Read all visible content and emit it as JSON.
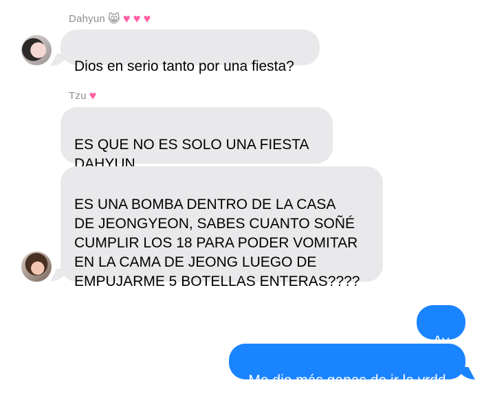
{
  "chat": {
    "groups": [
      {
        "sender": "Dahyun",
        "sender_icons": [
          "cat-face-icon",
          "pink-heart-icon",
          "pink-heart-icon",
          "pink-heart-icon"
        ],
        "messages": [
          "Dios en serio tanto por una fiesta?"
        ]
      },
      {
        "sender": "Tzu",
        "sender_icons": [
          "pink-heart-icon"
        ],
        "messages": [
          "ES QUE NO ES SOLO UNA FIESTA\nDAHYUN",
          "ES UNA BOMBA DENTRO DE LA CASA\nDE JEONGYEON, SABES CUANTO SOÑÉ\nCUMPLIR LOS 18 PARA PODER VOMITAR\nEN LA CAMA DE JEONG LUEGO DE\nEMPUJARME 5 BOTELLAS ENTERAS????"
        ]
      }
    ],
    "outgoing": [
      "Ay",
      "Me dio más ganas de ir la vrdd"
    ]
  },
  "colors": {
    "incoming_bubble": "#e9e9eb",
    "outgoing_bubble": "#1a84ff",
    "sender_text": "#8e8e93",
    "heart": "#ff5fa2"
  }
}
